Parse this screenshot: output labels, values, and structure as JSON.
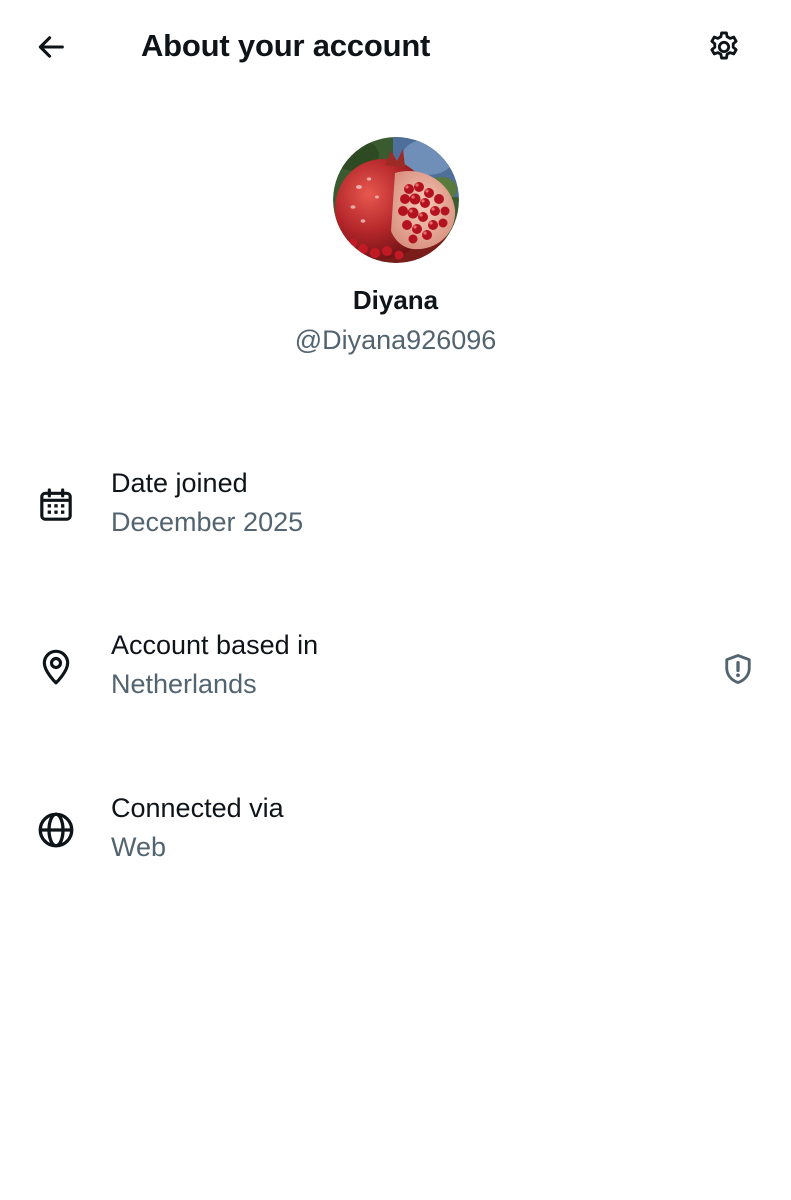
{
  "header": {
    "title": "About your account",
    "back_icon": "arrow-left-icon",
    "settings_icon": "gear-icon"
  },
  "profile": {
    "display_name": "Diyana",
    "handle": "@Diyana926096",
    "avatar": "pomegranate-photo"
  },
  "rows": [
    {
      "label": "Date joined",
      "value": "December 2025",
      "icon": "calendar-icon"
    },
    {
      "label": "Account based in",
      "value": "Netherlands",
      "icon": "location-pin-icon",
      "trailing_icon": "shield-alert-icon"
    },
    {
      "label": "Connected via",
      "value": "Web",
      "icon": "globe-icon"
    }
  ],
  "colors": {
    "primary_text": "#0f1419",
    "secondary_text": "#536471",
    "background": "#ffffff"
  }
}
